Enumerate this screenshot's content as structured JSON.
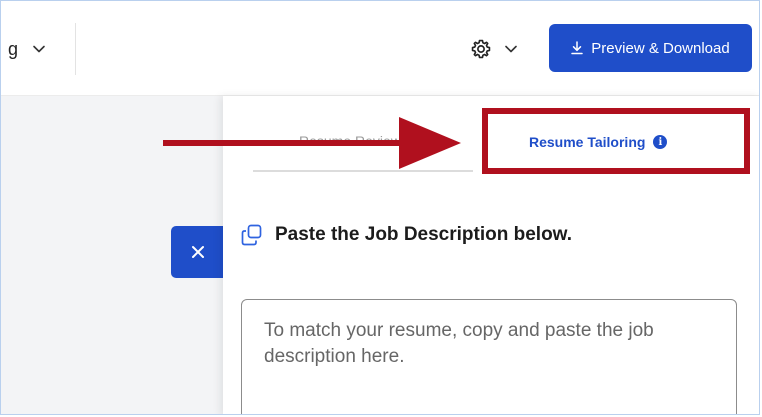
{
  "header": {
    "cut_text": "g",
    "preview_download_label": "Preview & Download"
  },
  "tabs": {
    "resume_review_label": "Resume Review",
    "resume_tailoring_label": "Resume Tailoring",
    "info_glyph": "i"
  },
  "main": {
    "section_title": "Paste the Job Description below.",
    "job_description": {
      "value": "",
      "placeholder": "To match your resume, copy and paste the job description here."
    }
  },
  "colors": {
    "accent": "#1f4ec9",
    "annotation": "#b0101e",
    "background": "#f3f4f6"
  },
  "icons": {
    "settings": "gear-icon",
    "dropdown": "chevron-down-icon",
    "download": "download-icon",
    "close": "close-icon",
    "info": "info-icon",
    "copy": "copy-icon"
  }
}
